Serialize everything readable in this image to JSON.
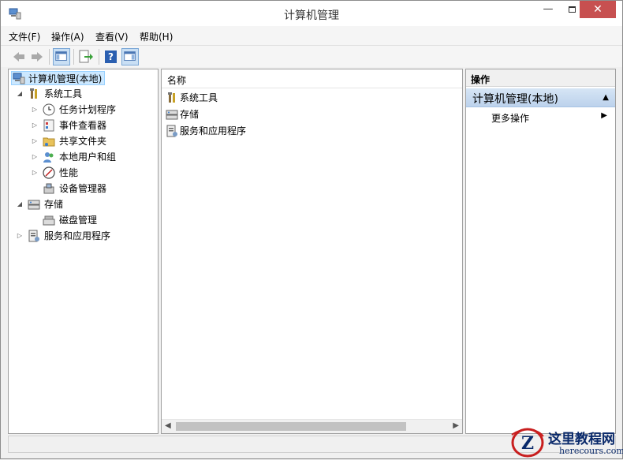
{
  "window": {
    "title": "计算机管理",
    "min_icon": "minimize-icon",
    "max_icon": "maximize-icon",
    "close_glyph": "✕"
  },
  "menu": {
    "items": [
      "文件(F)",
      "操作(A)",
      "查看(V)",
      "帮助(H)"
    ]
  },
  "toolbar": {
    "icons": [
      "back-arrow-icon",
      "forward-arrow-icon",
      "show-hide-console-tree-icon",
      "export-list-icon",
      "help-icon",
      "show-hide-action-pane-icon"
    ]
  },
  "tree": {
    "root": "计算机管理(本地)",
    "system_tools": "系统工具",
    "task_scheduler": "任务计划程序",
    "event_viewer": "事件查看器",
    "shared_folders": "共享文件夹",
    "local_users": "本地用户和组",
    "performance": "性能",
    "device_manager": "设备管理器",
    "storage": "存储",
    "disk_management": "磁盘管理",
    "services_apps": "服务和应用程序"
  },
  "list": {
    "column_name": "名称",
    "rows": [
      "系统工具",
      "存储",
      "服务和应用程序"
    ]
  },
  "actions": {
    "header": "操作",
    "section": "计算机管理(本地)",
    "more": "更多操作"
  },
  "watermark": {
    "title": "这里教程网",
    "url": "herecours.com"
  },
  "colors": {
    "selection": "#cce8ff",
    "action_section": "#c5d9f1",
    "close_button": "#c75050",
    "watermark_text": "#0a2a6b",
    "watermark_logo": "#c81e1e"
  }
}
